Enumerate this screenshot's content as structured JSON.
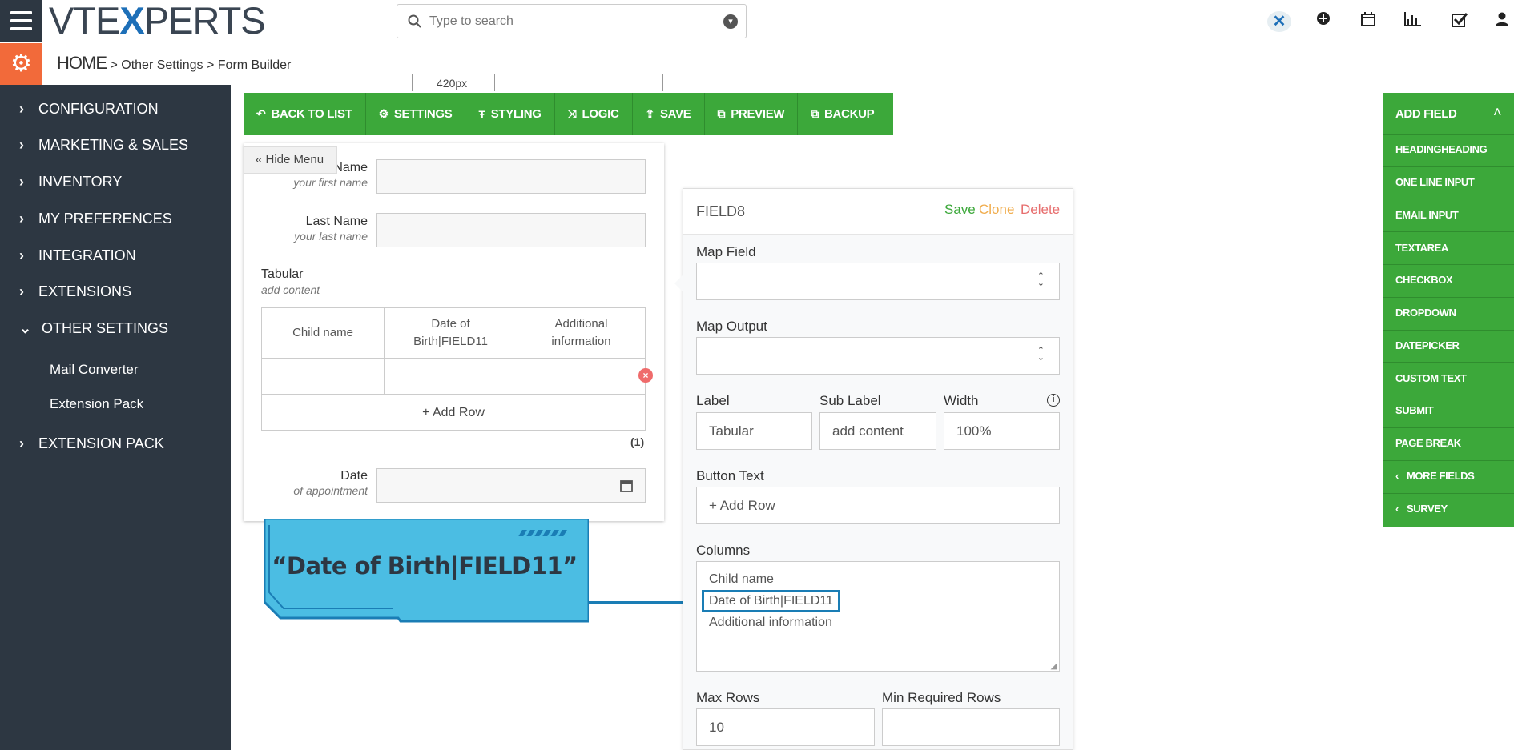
{
  "app": {
    "logo_text_1": "VTE",
    "logo_x": "X",
    "logo_text_2": "PERTS"
  },
  "search": {
    "placeholder": "Type to search"
  },
  "breadcrumb": {
    "home": "HOME",
    "item1": "Other Settings",
    "item2": "Form Builder",
    "sep": ">"
  },
  "sidebar": {
    "items": [
      {
        "label": "CONFIGURATION"
      },
      {
        "label": "MARKETING & SALES"
      },
      {
        "label": "INVENTORY"
      },
      {
        "label": "MY PREFERENCES"
      },
      {
        "label": "INTEGRATION"
      },
      {
        "label": "EXTENSIONS"
      },
      {
        "label": "OTHER SETTINGS"
      },
      {
        "label": "EXTENSION PACK"
      }
    ],
    "subitems": [
      "Mail Converter",
      "Extension Pack"
    ]
  },
  "ruler": {
    "width_label": "420px"
  },
  "toolbar": {
    "back": "BACK TO LIST",
    "settings": "SETTINGS",
    "styling": "STYLING",
    "logic": "LOGIC",
    "save": "SAVE",
    "preview": "PREVIEW",
    "backup": "BACKUP"
  },
  "form": {
    "hide_menu": "« Hide Menu",
    "first_name_label": "Name",
    "first_name_sub": "your first name",
    "last_name_label": "Last Name",
    "last_name_sub": "your last name",
    "tabular_label": "Tabular",
    "tabular_sub": "add content",
    "columns": [
      "Child name",
      "Date of Birth|FIELD11",
      "Additional information"
    ],
    "add_row": "+ Add Row",
    "row_count": "(1)",
    "date_label": "Date",
    "date_sub": "of appointment"
  },
  "callout": {
    "text": "“Date of Birth|FIELD11”"
  },
  "field_panel": {
    "title": "FIELD8",
    "save": "Save",
    "clone": "Clone",
    "delete": "Delete",
    "map_field_label": "Map Field",
    "map_output_label": "Map Output",
    "label_label": "Label",
    "label_value": "Tabular",
    "sublabel_label": "Sub Label",
    "sublabel_value": "add content",
    "width_label": "Width",
    "width_value": "100%",
    "button_text_label": "Button Text",
    "button_text_value": "+ Add Row",
    "columns_label": "Columns",
    "columns_lines": [
      "Child name",
      "Date of Birth|FIELD11",
      "Additional information"
    ],
    "max_rows_label": "Max Rows",
    "max_rows_value": "10",
    "min_rows_label": "Min Required Rows",
    "min_rows_value": ""
  },
  "add_field": {
    "title": "ADD FIELD",
    "items": [
      "HEADINGHEADING",
      "ONE LINE INPUT",
      "EMAIL INPUT",
      "TEXTAREA",
      "CHECKBOX",
      "DROPDOWN",
      "DATEPICKER",
      "CUSTOM TEXT",
      "SUBMIT",
      "PAGE BREAK"
    ],
    "more_fields": "MORE FIELDS",
    "survey": "SURVEY"
  },
  "colors": {
    "sidebar": "#2d3742",
    "accent_orange": "#f26a3a",
    "green": "#3ca83a",
    "callout_blue": "#4bbde3",
    "save": "#3ca83a",
    "clone": "#f0ad4e",
    "delete": "#e76e6e"
  }
}
